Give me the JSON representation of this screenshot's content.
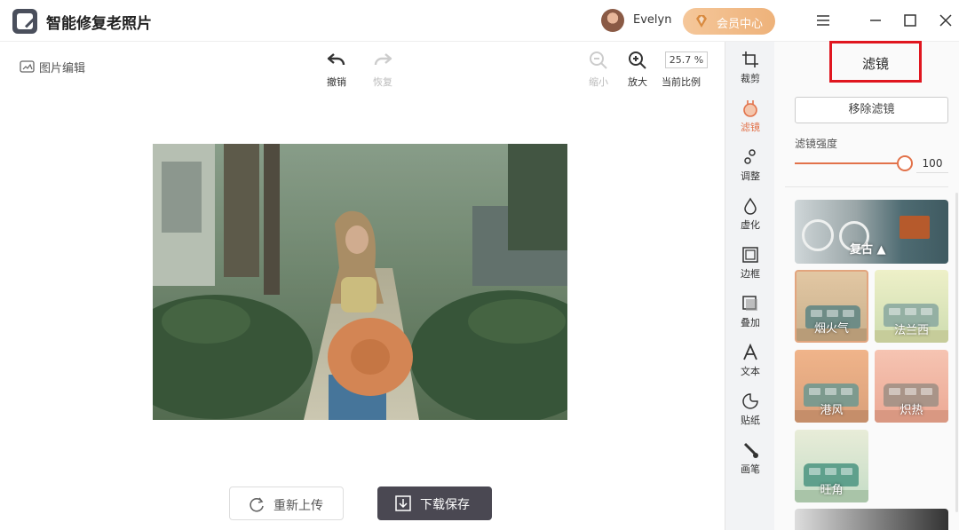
{
  "app": {
    "title": "智能修复老照片",
    "username": "Evelyn",
    "vip_label": "会员中心"
  },
  "canvas": {
    "breadcrumb": "图片编辑",
    "toolbar": {
      "undo": "撤销",
      "redo": "恢复",
      "zoom_out": "缩小",
      "zoom_in": "放大",
      "zoom_value": "25.7 %",
      "ratio_label": "当前比例"
    },
    "reupload_label": "重新上传",
    "download_label": "下载保存"
  },
  "rail": {
    "items": [
      {
        "label": "裁剪",
        "icon": "crop-icon",
        "active": false
      },
      {
        "label": "滤镜",
        "icon": "filter-icon",
        "active": true
      },
      {
        "label": "调整",
        "icon": "adjust-icon",
        "active": false
      },
      {
        "label": "虚化",
        "icon": "blur-drop-icon",
        "active": false
      },
      {
        "label": "边框",
        "icon": "border-frame-icon",
        "active": false
      },
      {
        "label": "叠加",
        "icon": "overlay-icon",
        "active": false
      },
      {
        "label": "文本",
        "icon": "text-icon",
        "active": false
      },
      {
        "label": "贴纸",
        "icon": "sticker-icon",
        "active": false
      },
      {
        "label": "画笔",
        "icon": "brush-icon",
        "active": false
      }
    ]
  },
  "panel": {
    "title": "滤镜",
    "remove_filter": "移除滤镜",
    "strength_label": "滤镜强度",
    "strength_value": "100",
    "strength_fraction": 1.0,
    "category": "复古",
    "filters": [
      {
        "label": "烟火气",
        "selected": true
      },
      {
        "label": "法兰西",
        "selected": false
      },
      {
        "label": "港风",
        "selected": false
      },
      {
        "label": "炽热",
        "selected": false
      },
      {
        "label": "旺角",
        "selected": false
      }
    ]
  },
  "colors": {
    "accent": "#e2724a",
    "highlight_box": "#e0161f",
    "download_bg": "#4a4852",
    "vip_gold": "#f5c79a"
  }
}
